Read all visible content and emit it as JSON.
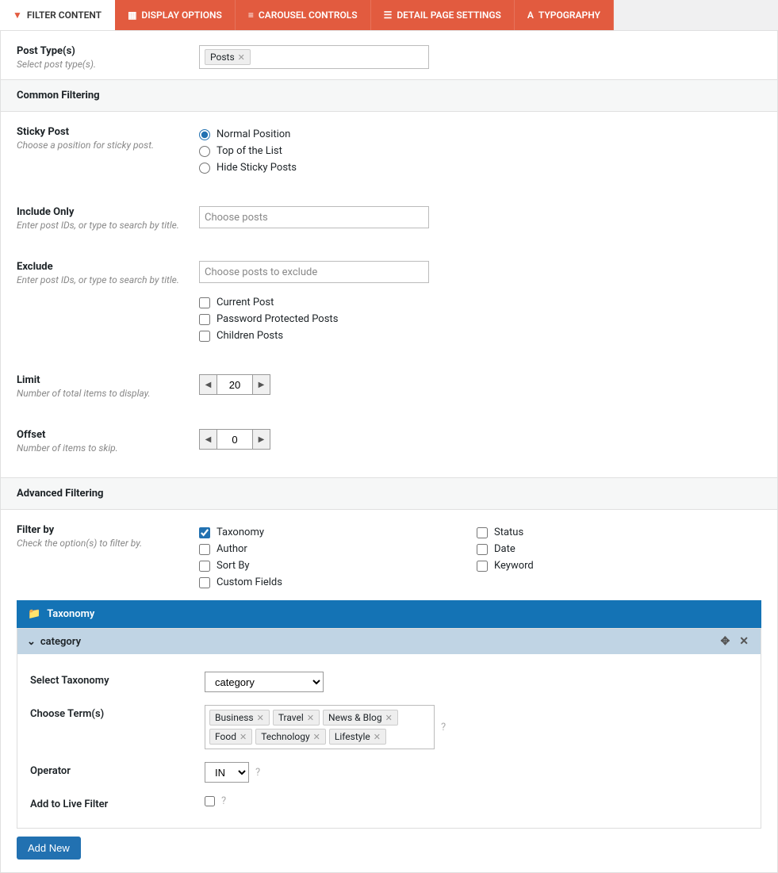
{
  "tabs": [
    {
      "label": "FILTER CONTENT",
      "icon": "filter"
    },
    {
      "label": "DISPLAY OPTIONS",
      "icon": "grid"
    },
    {
      "label": "CAROUSEL CONTROLS",
      "icon": "sliders"
    },
    {
      "label": "DETAIL PAGE SETTINGS",
      "icon": "page"
    },
    {
      "label": "TYPOGRAPHY",
      "icon": "font"
    }
  ],
  "post_type": {
    "label": "Post Type(s)",
    "desc": "Select post type(s).",
    "tokens": [
      "Posts"
    ]
  },
  "section_common": "Common Filtering",
  "sticky": {
    "label": "Sticky Post",
    "desc": "Choose a position for sticky post.",
    "options": [
      "Normal Position",
      "Top of the List",
      "Hide Sticky Posts"
    ],
    "selected": 0
  },
  "include": {
    "label": "Include Only",
    "desc": "Enter post IDs, or type to search by title.",
    "placeholder": "Choose posts"
  },
  "exclude": {
    "label": "Exclude",
    "desc": "Enter post IDs, or type to search by title.",
    "placeholder": "Choose posts to exclude",
    "checks": [
      "Current Post",
      "Password Protected Posts",
      "Children Posts"
    ]
  },
  "limit": {
    "label": "Limit",
    "desc": "Number of total items to display.",
    "value": "20"
  },
  "offset": {
    "label": "Offset",
    "desc": "Number of items to skip.",
    "value": "0"
  },
  "section_adv": "Advanced Filtering",
  "filterby": {
    "label": "Filter by",
    "desc": "Check the option(s) to filter by.",
    "col1": [
      "Taxonomy",
      "Author",
      "Sort By",
      "Custom Fields"
    ],
    "col2": [
      "Status",
      "Date",
      "Keyword"
    ],
    "checked": [
      "Taxonomy"
    ]
  },
  "taxonomy": {
    "bar": "Taxonomy",
    "cat_title": "category",
    "select_label": "Select Taxonomy",
    "select_value": "category",
    "terms_label": "Choose Term(s)",
    "terms": [
      "Business",
      "Travel",
      "News & Blog",
      "Food",
      "Technology",
      "Lifestyle"
    ],
    "operator_label": "Operator",
    "operator_value": "IN",
    "live_label": "Add to Live Filter",
    "add_new": "Add New"
  }
}
